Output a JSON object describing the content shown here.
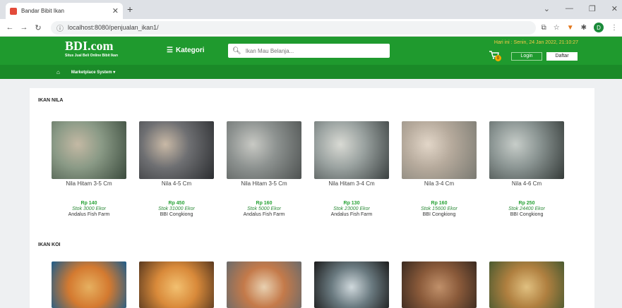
{
  "browser": {
    "tab_title": "Bandar Bibit Ikan",
    "url": "localhost:8080/penjualan_ikan1/"
  },
  "header": {
    "logo": "BDI.com",
    "tagline": "Situs Jual Beli Online Bibit Ikan",
    "kategori_label": "Kategori",
    "search_placeholder": "Ikan Mau Belanja...",
    "date_text": "Hari ini : Senin, 24 Jan 2022, 21:10:27",
    "cart_count": "0",
    "login_label": "Login",
    "daftar_label": "Daftar"
  },
  "subnav": {
    "marketplace_label": "Marketplace System ▾"
  },
  "sections": [
    {
      "title": "IKAN NILA",
      "products": [
        {
          "name": "Nila Hitam 3-5 Cm",
          "price": "Rp 140",
          "stock": "Stok 3000 Ekor",
          "seller": "Andalus Fish Farm"
        },
        {
          "name": "Nila 4-5 Cm",
          "price": "Rp 450",
          "stock": "Stok 31000 Ekor",
          "seller": "BBI Congkiong"
        },
        {
          "name": "Nila Hitam 3-5 Cm",
          "price": "Rp 160",
          "stock": "Stok 5000 Ekor",
          "seller": "Andalus Fish Farm"
        },
        {
          "name": "Nila Hitam 3-4 Cm",
          "price": "Rp 130",
          "stock": "Stok 23000 Ekor",
          "seller": "Andalus Fish Farm"
        },
        {
          "name": "Nila 3-4 Cm",
          "price": "Rp 160",
          "stock": "Stok 15600 Ekor",
          "seller": "BBI Congkiong"
        },
        {
          "name": "Nila 4-6 Cm",
          "price": "Rp 250",
          "stock": "Stok 24400 Ekor",
          "seller": "BBI Congkiong"
        }
      ]
    },
    {
      "title": "IKAN KOI",
      "products": []
    }
  ]
}
